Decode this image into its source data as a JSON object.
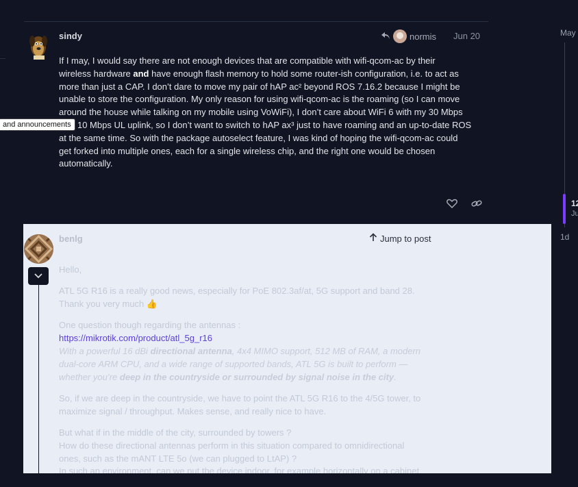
{
  "post1": {
    "username": "sindy",
    "reply_to_user": "normis",
    "date": "Jun 20",
    "body": {
      "l1": "If I may, I would say there are not enough devices that are compatible with wifi-qcom-ac by their",
      "l2a": "wireless hardware ",
      "l2b": "and",
      "l2c": " have enough flash memory to hold some router-ish configuration, i.e. to act as",
      "l3": "more than just a CAP. I don’t dare to move my pair of hAP ac² beyond ROS 7.16.2 because I might be",
      "l4": "unable to store the configuration. My only reason for using wifi-qcom-ac is the roaming (so I can move",
      "l5": "around the house while talking on my mobile using VoWiFi), I don’t care about WiFi 6 with my 30 Mbps",
      "l6": "DL / 10 Mbps UL uplink, so I don’t want to switch to hAP ax³ just to have roaming and an up-to-date ROS",
      "l7": "at the same time. So with the package autoselect feature, I was kind of hoping the wifi-qcom-ac could",
      "l8": "get forked into multiple ones, each for a single wireless chip, and the right one would be chosen",
      "l9": "automatically."
    },
    "like_icon": "heart-icon",
    "link_icon": "link-icon"
  },
  "tooltip": "and announcements",
  "timeline": {
    "top_date": "May",
    "current": "12",
    "current_sub": "Ju",
    "bottom_date": "1d",
    "accent": "#7a3cff"
  },
  "quoted": {
    "username": "benlg",
    "jump_label": "Jump to post",
    "greeting": "Hello,",
    "p2a": "ATL 5G R16 is a really good news, especially for PoE 802.3af/at, 5G support and band 28.",
    "p2b": "Thank you very much ",
    "thumbs": "👍",
    "p3": "One question though regarding the antennas :",
    "link": "https://mikrotik.com/product/atl_5g_r16",
    "q1": "With a powerful 16 dBi ",
    "q1b": "directional antenna",
    "q1c": ", 4x4 MIMO support, 512 MB of RAM, a modern",
    "q2": "dual-core ARM CPU, and a wide range of supported bands, ATL 5G is built to perform —",
    "q3": "whether you’re ",
    "q3b": "deep in the countryside or surrounded by signal noise in the city",
    "q3c": ".",
    "p4a": "So, if we are deep in the countryside, we have to point the ATL 5G R16 to the 4/5G tower, to",
    "p4b": "maximize signal / throughput. Makes sense, and really nice to have.",
    "p5a": "But what if in the middle of the city, surrounded by towers ?",
    "p5b": "How do these directional antennas perform in this situation compared to omnidirectional",
    "p5c": "ones, such as the mANT LTE 5o (we can plugged to LtAP) ?",
    "p5d": "In such an environment, can we put the device indoor, for example horizontally on a cabinet"
  }
}
